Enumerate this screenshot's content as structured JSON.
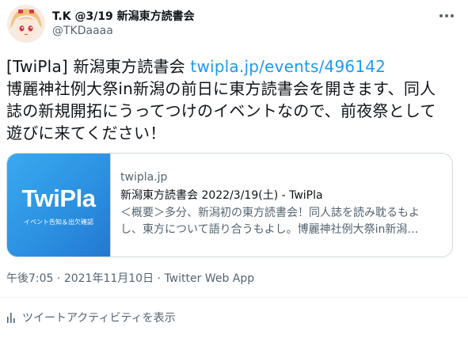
{
  "author": {
    "display_name": "T.K @3/19 新潟東方読書会",
    "handle": "@TKDaaaa"
  },
  "tweet": {
    "text_before_link": "[TwiPla] 新潟東方読書会 ",
    "link_text": "twipla.jp/events/496142",
    "text_after_link": "\n博麗神社例大祭in新潟の前日に東方読書会を開きます、同人誌の新規開拓にうってつけのイベントなので、前夜祭として遊びに来てください！"
  },
  "card": {
    "image_logo_text": "TwiPla",
    "image_sub_text": "イベント告知＆出欠確認",
    "domain": "twipla.jp",
    "title": "新潟東方読書会 2022/3/19(土) - TwiPla",
    "description": "＜概要＞多分、新潟初の東方読書会！同人誌を読み耽るもよし、東方について語り合うもよし。博麗神社例大祭in新潟…"
  },
  "meta": {
    "time": "午後7:05",
    "separator": "·",
    "date": "2021年11月10日",
    "source": "Twitter Web App"
  },
  "actions": {
    "activity_label": "ツイートアクティビティを表示"
  },
  "colors": {
    "link": "#1d9bf0",
    "secondary_text": "#536471",
    "card_border": "#cfd9de"
  }
}
